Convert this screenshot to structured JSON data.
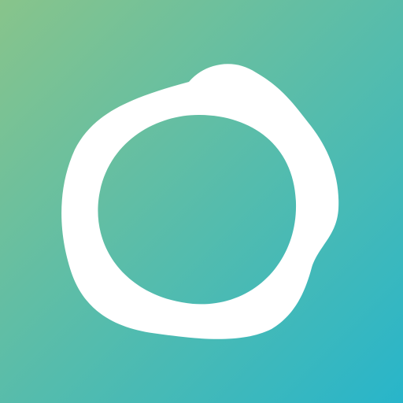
{
  "icon": {
    "semantic": "blob-ring-icon",
    "colors": {
      "gradient_start": "#88c48b",
      "gradient_end": "#28b5ca",
      "ring": "#ffffff"
    }
  }
}
